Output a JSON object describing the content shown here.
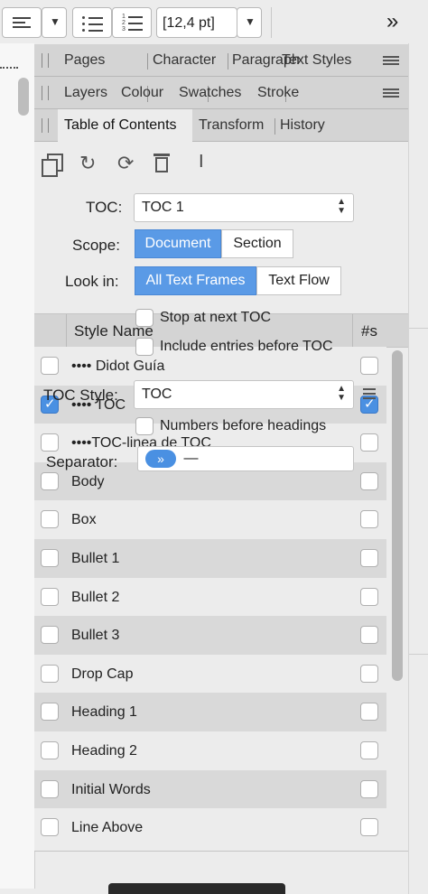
{
  "toolbar": {
    "font_size": "[12,4 pt]",
    "overflow": "»",
    "dropdown_arrow": "▼"
  },
  "panels": {
    "row1": [
      "Pages",
      "Character",
      "Paragraph",
      "Text Styles"
    ],
    "row2": [
      "Layers",
      "Colour",
      "Swatches",
      "Stroke"
    ],
    "row3": [
      "Table of Contents",
      "Transform",
      "History"
    ],
    "active_tab": "Table of Contents"
  },
  "toc": {
    "toc_label": "TOC:",
    "toc_value": "TOC 1",
    "scope_label": "Scope:",
    "scope_options": [
      "Document",
      "Section"
    ],
    "scope_selected": "Document",
    "lookin_label": "Look in:",
    "lookin_options": [
      "All Text Frames",
      "Text Flow"
    ],
    "lookin_selected": "All Text Frames",
    "table_header_name": "Style Name",
    "table_header_count": "#s",
    "stop_next": "Stop at next TOC",
    "include_before": "Include entries before TOC",
    "toc_style_label": "TOC Style:",
    "toc_style_value": "TOC",
    "numbers_before": "Numbers before headings",
    "separator_label": "Separator:",
    "separator_token": "»",
    "separator_text": "—"
  },
  "styles": [
    {
      "name": "•••• Didot Guía",
      "checked": false
    },
    {
      "name": "•••• TOC",
      "checked": true
    },
    {
      "name": "••••TOC-linea de TOC",
      "checked": false
    },
    {
      "name": "Body",
      "checked": false
    },
    {
      "name": "Box",
      "checked": false
    },
    {
      "name": "Bullet 1",
      "checked": false
    },
    {
      "name": "Bullet 2",
      "checked": false
    },
    {
      "name": "Bullet 3",
      "checked": false
    },
    {
      "name": "Drop Cap",
      "checked": false
    },
    {
      "name": "Heading 1",
      "checked": false
    },
    {
      "name": "Heading 2",
      "checked": false
    },
    {
      "name": "Initial Words",
      "checked": false
    },
    {
      "name": "Line Above",
      "checked": false
    }
  ],
  "colors": {
    "accent": "#5a9ae6",
    "check": "#4a90e2",
    "row_alt": "#d9d9d9"
  }
}
